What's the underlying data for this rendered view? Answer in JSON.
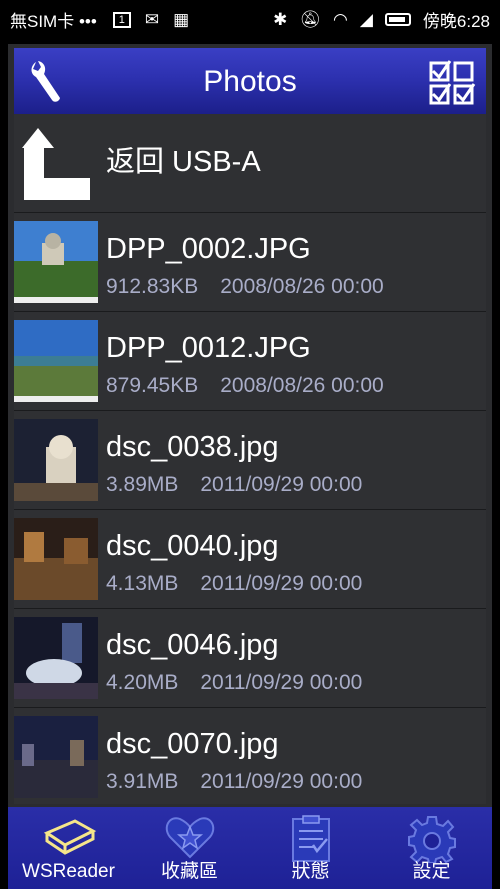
{
  "status_bar": {
    "carrier": "無SIM卡 •••",
    "sim_slot": "1",
    "time": "傍晚6:28"
  },
  "header": {
    "title": "Photos"
  },
  "back_row": {
    "label": "返回 USB-A"
  },
  "files": [
    {
      "name": "DPP_0002.JPG",
      "size": "912.83KB",
      "date": "2008/08/26 00:00"
    },
    {
      "name": "DPP_0012.JPG",
      "size": "879.45KB",
      "date": "2008/08/26 00:00"
    },
    {
      "name": "dsc_0038.jpg",
      "size": "3.89MB",
      "date": "2011/09/29 00:00"
    },
    {
      "name": "dsc_0040.jpg",
      "size": "4.13MB",
      "date": "2011/09/29 00:00"
    },
    {
      "name": "dsc_0046.jpg",
      "size": "4.20MB",
      "date": "2011/09/29 00:00"
    },
    {
      "name": "dsc_0070.jpg",
      "size": "3.91MB",
      "date": "2011/09/29 00:00"
    }
  ],
  "tabs": [
    {
      "label": "WSReader",
      "icon": "drive-icon",
      "active": true
    },
    {
      "label": "收藏區",
      "icon": "heart-star-icon"
    },
    {
      "label": "狀態",
      "icon": "clipboard-icon"
    },
    {
      "label": "設定",
      "icon": "gear-icon"
    }
  ],
  "colors": {
    "header": "#2d31b0",
    "tabbar": "#2a2ea8",
    "active_tab": "#f5e68a",
    "meta_text": "#a9adc8",
    "row_bg": "#2f3033"
  }
}
